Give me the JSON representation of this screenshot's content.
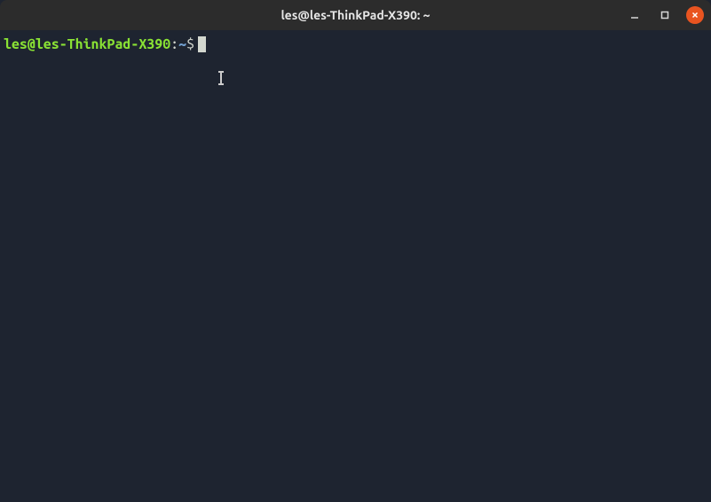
{
  "window": {
    "title": "les@les-ThinkPad-X390: ~"
  },
  "prompt": {
    "user_host": "les@les-ThinkPad-X390",
    "separator": ":",
    "cwd": "~",
    "symbol": "$"
  },
  "colors": {
    "titlebar_bg": "#2c2c2c",
    "terminal_bg": "#1e2430",
    "user_host": "#8ae234",
    "cwd": "#729fcf",
    "text": "#d3d7cf",
    "close_btn": "#e95420"
  }
}
